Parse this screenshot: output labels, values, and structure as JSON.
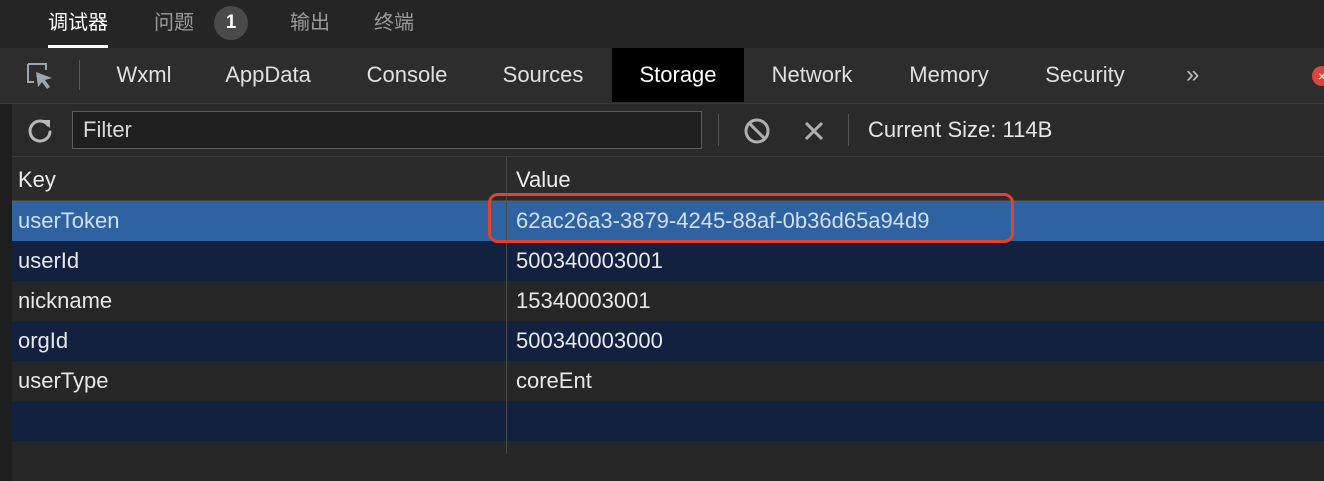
{
  "top_tabs": [
    {
      "label": "调试器",
      "active": true
    },
    {
      "label": "问题",
      "active": false,
      "badge": "1"
    },
    {
      "label": "输出",
      "active": false
    },
    {
      "label": "终端",
      "active": false
    }
  ],
  "devtools_tabs": [
    {
      "label": "Wxml"
    },
    {
      "label": "AppData"
    },
    {
      "label": "Console"
    },
    {
      "label": "Sources"
    },
    {
      "label": "Storage",
      "active": true
    },
    {
      "label": "Network"
    },
    {
      "label": "Memory"
    },
    {
      "label": "Security"
    }
  ],
  "more_label": "»",
  "error_indicator": "×",
  "toolbar": {
    "filter_placeholder": "Filter",
    "current_size_label": "Current Size: 114B"
  },
  "table": {
    "columns": [
      "Key",
      "Value"
    ],
    "rows": [
      {
        "key": "userToken",
        "value": "62ac26a3-3879-4245-88af-0b36d65a94d9",
        "selected": true
      },
      {
        "key": "userId",
        "value": "500340003001"
      },
      {
        "key": "nickname",
        "value": "15340003001"
      },
      {
        "key": "orgId",
        "value": "500340003000"
      },
      {
        "key": "userType",
        "value": "coreEnt"
      }
    ]
  },
  "colors": {
    "selected_row": "#2f62a0",
    "highlight_box": "#e2432f",
    "error_badge": "#e0443c"
  },
  "icons": {
    "inspect": "inspect-cursor-icon",
    "refresh": "refresh-icon",
    "clear": "block-icon",
    "delete": "close-icon"
  }
}
